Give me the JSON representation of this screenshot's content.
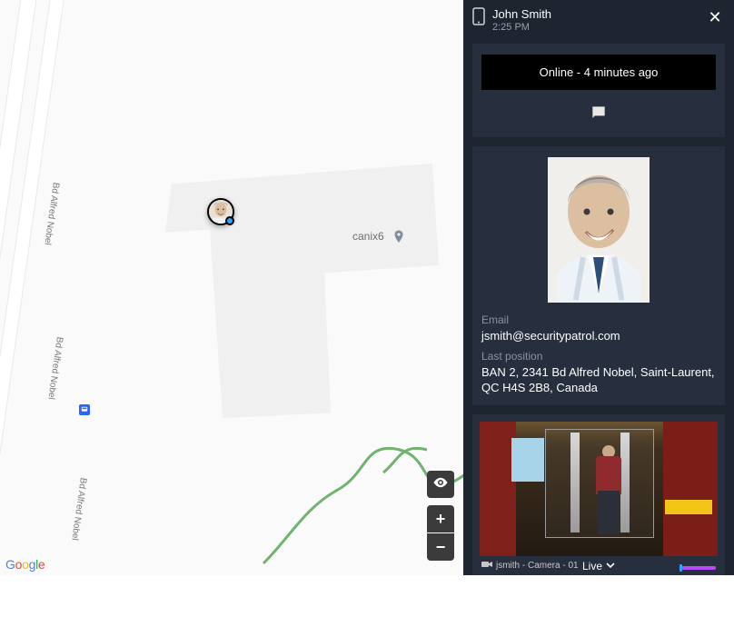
{
  "map": {
    "road_label": "Bd Alfred Nobel",
    "poi": {
      "name": "canix6"
    },
    "attribution": "Google"
  },
  "panel": {
    "header": {
      "name": "John Smith",
      "time": "2:25 PM"
    },
    "status": {
      "text": "Online  -  4 minutes ago"
    },
    "email_label": "Email",
    "email_value": "jsmith@securitypatrol.com",
    "position_label": "Last position",
    "position_value": "BAN 2, 2341 Bd Alfred Nobel, Saint-Laurent, QC H4S 2B8, Canada",
    "camera": {
      "name": "jsmith - Camera - 01",
      "mode": "Live"
    }
  }
}
